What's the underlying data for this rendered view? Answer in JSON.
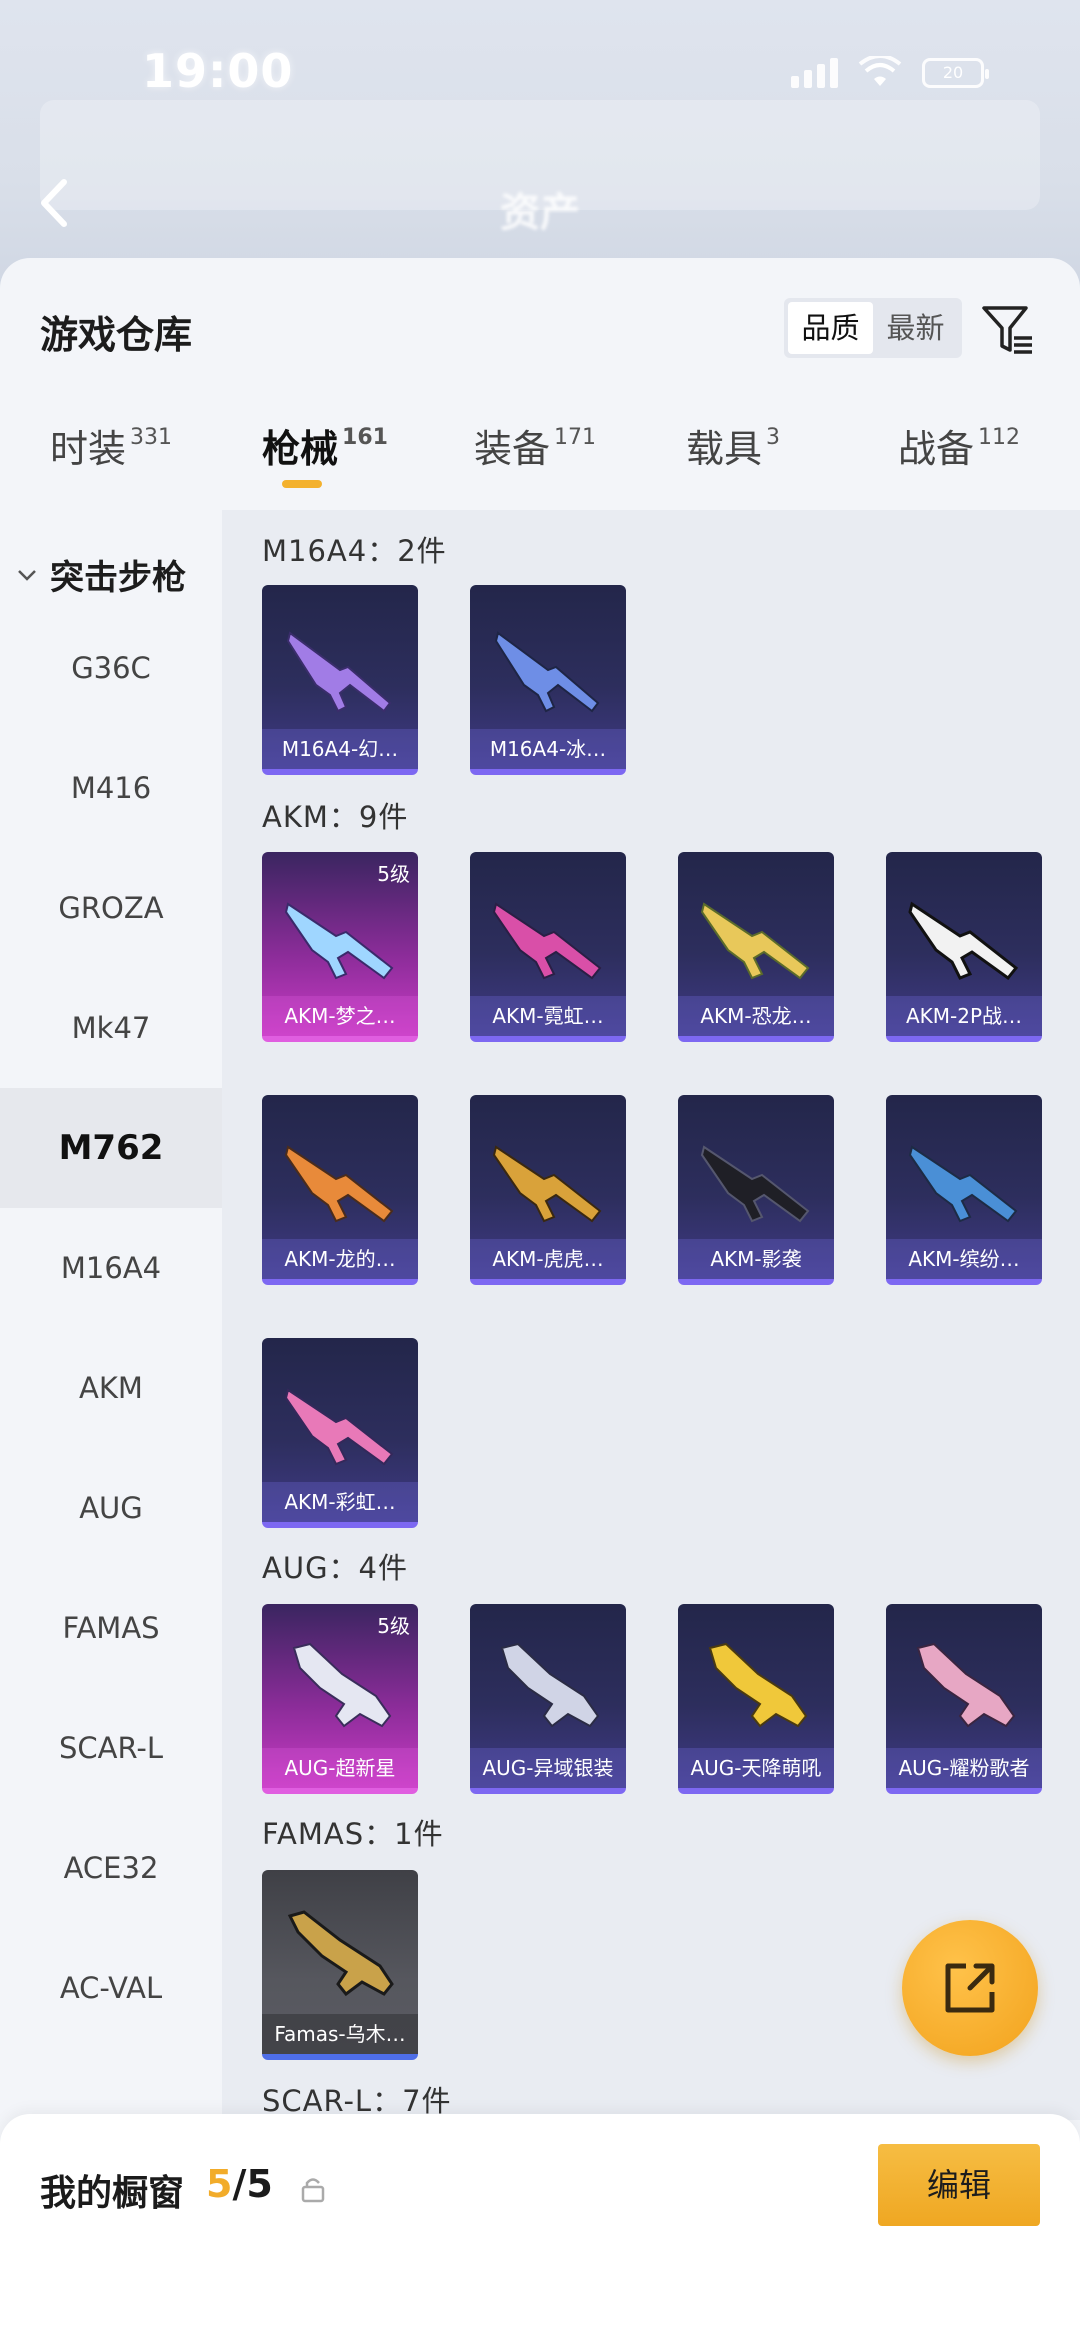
{
  "status_bar": {
    "time": "19:00",
    "battery": "20"
  },
  "nav": {
    "title": "资产"
  },
  "sheet": {
    "title": "游戏仓库",
    "sort": [
      "品质",
      "最新"
    ]
  },
  "tabs": [
    {
      "label": "时装",
      "count": "331"
    },
    {
      "label": "枪械",
      "count": "161"
    },
    {
      "label": "装备",
      "count": "171"
    },
    {
      "label": "载具",
      "count": "3"
    },
    {
      "label": "战备",
      "count": "112"
    }
  ],
  "sidebar": {
    "group": "突击步枪",
    "items": [
      "G36C",
      "M416",
      "GROZA",
      "Mk47",
      "M762",
      "M16A4",
      "AKM",
      "AUG",
      "FAMAS",
      "SCAR-L",
      "ACE32",
      "AC-VAL"
    ]
  },
  "sections": [
    {
      "title": "M16A4：2件",
      "items": [
        {
          "name": "M16A4-幻…"
        },
        {
          "name": "M16A4-冰…"
        }
      ]
    },
    {
      "title": "AKM：9件",
      "items": [
        {
          "name": "AKM-梦之…",
          "level": "5级"
        },
        {
          "name": "AKM-霓虹…"
        },
        {
          "name": "AKM-恐龙…"
        },
        {
          "name": "AKM-2P战…"
        },
        {
          "name": "AKM-龙的…"
        },
        {
          "name": "AKM-虎虎…"
        },
        {
          "name": "AKM-影袭"
        },
        {
          "name": "AKM-缤纷…"
        },
        {
          "name": "AKM-彩虹…"
        }
      ]
    },
    {
      "title": "AUG：4件",
      "items": [
        {
          "name": "AUG-超新星",
          "level": "5级"
        },
        {
          "name": "AUG-异域银装"
        },
        {
          "name": "AUG-天降萌吼"
        },
        {
          "name": "AUG-耀粉歌者"
        }
      ]
    },
    {
      "title": "FAMAS：1件",
      "items": [
        {
          "name": "Famas-乌木…"
        }
      ]
    },
    {
      "title": "SCAR-L：7件",
      "items": []
    }
  ],
  "bottom": {
    "label": "我的橱窗",
    "count_current": "5",
    "count_total": "/5",
    "edit": "编辑"
  },
  "colors": {
    "accent": "#f2ac2a",
    "card_purple": "#2d2e5d",
    "card_pink": "#c83bc4"
  },
  "icons": [
    "back-icon",
    "filter-icon",
    "chevron-down-icon",
    "lock-icon",
    "share-icon"
  ]
}
